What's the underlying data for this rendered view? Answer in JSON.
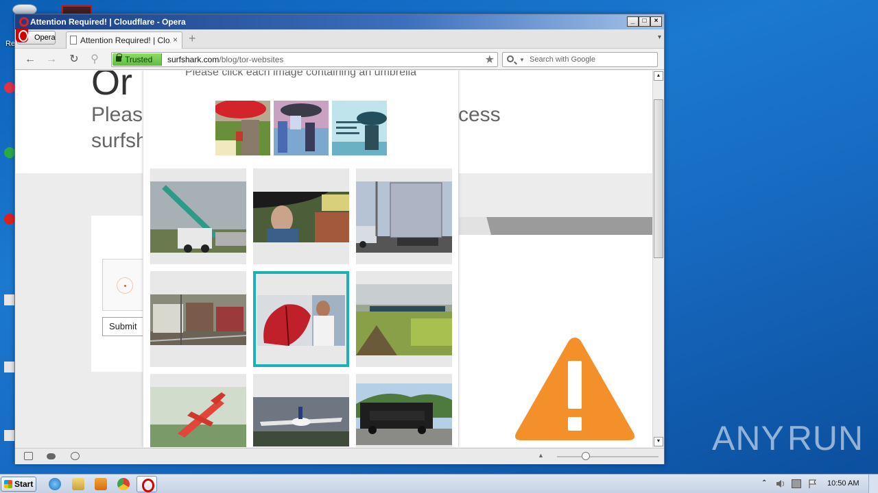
{
  "window": {
    "title": "Attention Required! | Cloudflare - Opera",
    "controls": {
      "minimize": "_",
      "maximize": "□",
      "close": "×"
    }
  },
  "menu": {
    "opera_label": "Opera"
  },
  "tab": {
    "title": "Attention Required! | Clo...",
    "close": "×",
    "new_tab": "+"
  },
  "address": {
    "trusted_label": "Trusted",
    "host": "surfshark.com",
    "path": "/blog/tor-websites"
  },
  "search": {
    "placeholder": "Search with Google"
  },
  "page": {
    "heading_partial": "Or",
    "please_partial": "Pleas",
    "access_partial": "ccess",
    "surf_partial": "surfsh",
    "submit_label": "Submit"
  },
  "captcha": {
    "instruction": "Please click each image containing an umbrella",
    "tiles": [
      {
        "name": "crane-truck",
        "selected": false
      },
      {
        "name": "man-under-umbrella",
        "selected": false
      },
      {
        "name": "box-truck",
        "selected": false
      },
      {
        "name": "freight-trucks",
        "selected": false
      },
      {
        "name": "red-umbrella",
        "selected": true
      },
      {
        "name": "grass-field-train",
        "selected": false
      },
      {
        "name": "red-airplane",
        "selected": false
      },
      {
        "name": "jet-landing",
        "selected": false
      },
      {
        "name": "bus-with-sign",
        "selected": false
      }
    ],
    "selected_color": "#1ab3b5"
  },
  "taskbar": {
    "start_label": "Start",
    "clock": "10:50 AM"
  },
  "watermark": {
    "text_left": "ANY",
    "text_right": "RUN"
  },
  "desktop": {
    "icon_label": "Re"
  },
  "colors": {
    "trusted_green": "#5cbf3b",
    "warning_orange": "#f4902a",
    "opera_red": "#d40000"
  }
}
